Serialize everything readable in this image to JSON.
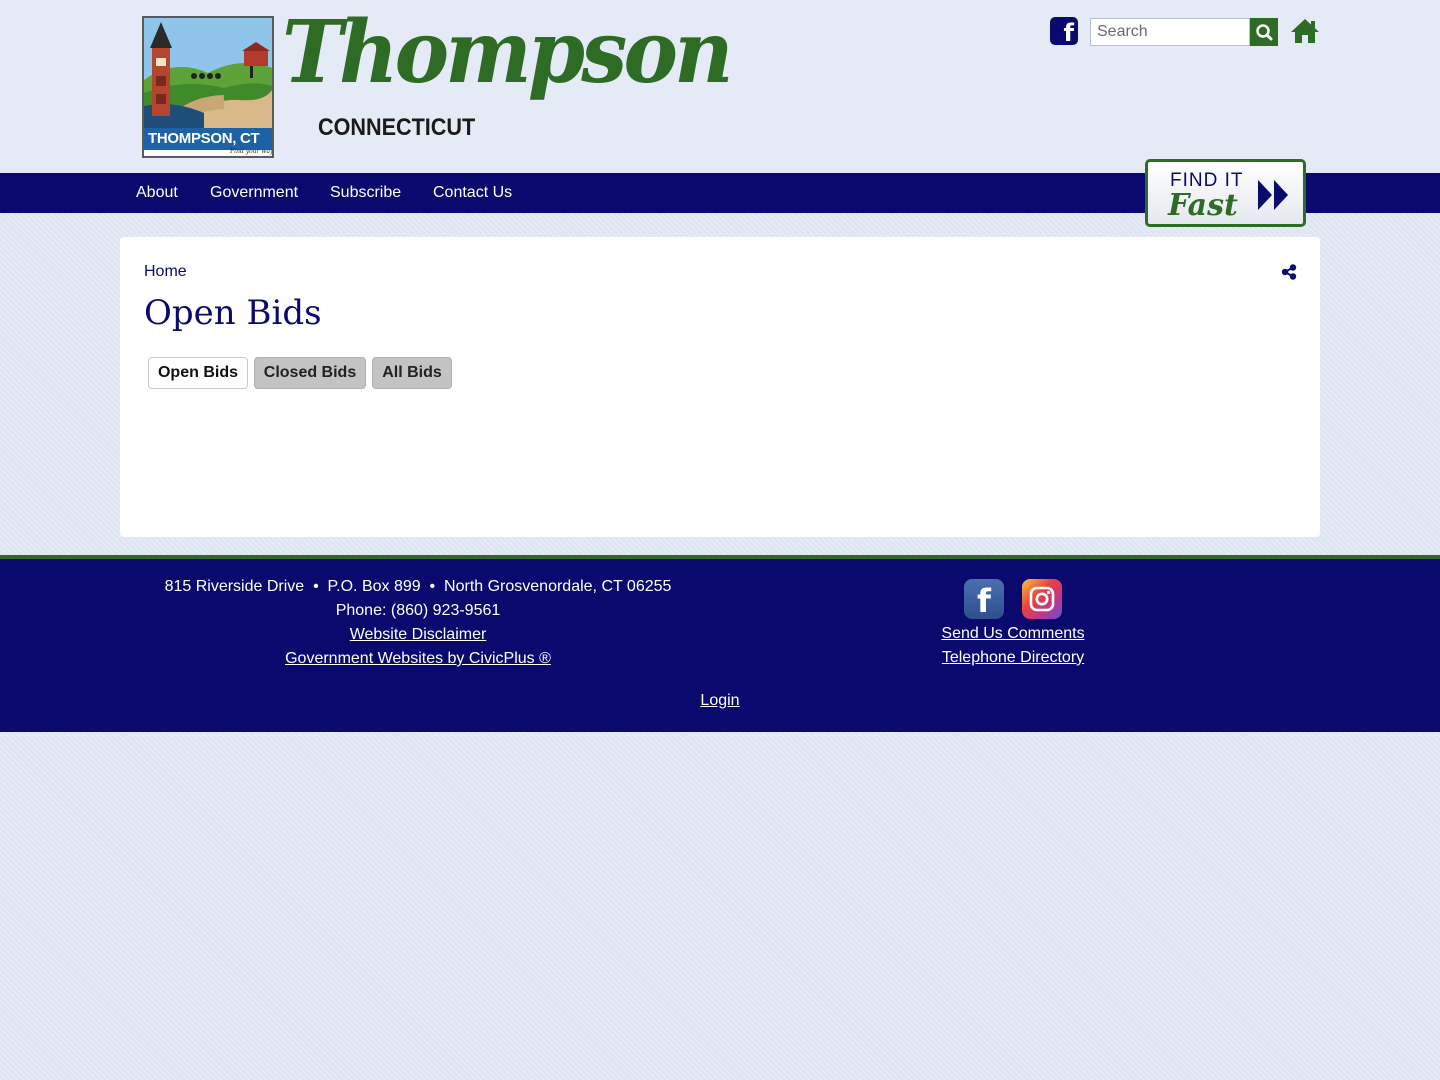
{
  "header": {
    "logo_badge_text": "THOMPSON, CT",
    "logo_badge_tagline": "Find your way",
    "wordmark": "Thompson",
    "wordmark_sub": "CONNECTICUT",
    "search": {
      "placeholder": "Search",
      "value": ""
    },
    "icons": {
      "facebook": "facebook-icon",
      "search": "search-icon",
      "home": "home-icon"
    }
  },
  "nav": {
    "items": [
      {
        "label": "About"
      },
      {
        "label": "Government"
      },
      {
        "label": "Subscribe"
      },
      {
        "label": "Contact Us"
      }
    ],
    "find_it_fast": {
      "line1": "FIND IT",
      "line2": "Fast"
    }
  },
  "main": {
    "breadcrumb": "Home",
    "title": "Open Bids",
    "tabs": [
      {
        "label": "Open Bids",
        "active": true
      },
      {
        "label": "Closed Bids",
        "active": false
      },
      {
        "label": "All Bids",
        "active": false
      }
    ]
  },
  "footer": {
    "address": "815 Riverside Drive  •  P.O. Box 899  •  North Grosvenordale, CT 06255",
    "phone": "Phone: (860) 923-9561",
    "disclaimer": "Website Disclaimer",
    "civicplus": "Government Websites by CivicPlus ®",
    "send_comments": "Send Us Comments",
    "telephone_directory": "Telephone Directory",
    "login": "Login"
  },
  "colors": {
    "navy": "#0a0a6e",
    "green": "#2e6b25",
    "header_bg": "#e5ebf6",
    "page_bg": "#dfe5f2"
  }
}
